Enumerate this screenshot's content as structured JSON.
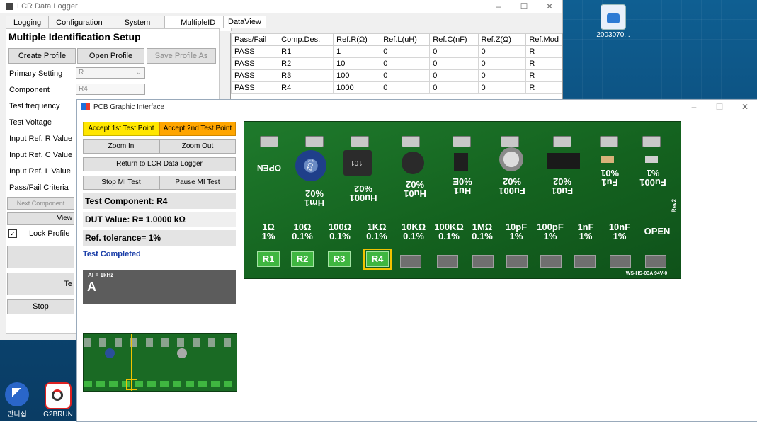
{
  "lcr": {
    "title": "LCR Data Logger",
    "tabs": [
      "Logging",
      "Configuration",
      "System",
      "MultipleID"
    ],
    "setup_title": "Multiple Identification  Setup",
    "buttons": {
      "create_profile": "Create Profile",
      "open_profile": "Open Profile",
      "save_profile_as": "Save Profile As",
      "next_component": "Next Component",
      "view": "View",
      "stop": "Stop",
      "te": "Te"
    },
    "labels": {
      "primary_setting": "Primary Setting",
      "component": "Component",
      "test_frequency": "Test frequency",
      "test_voltage": "Test Voltage",
      "input_ref_r": "Input Ref. R Value",
      "input_ref_c": "Input Ref. C Value",
      "input_ref_l": "Input Ref. L Value",
      "pass_fail": "Pass/Fail Criteria",
      "lock_profile": "Lock Profile"
    },
    "values": {
      "primary_setting": "R",
      "component": "R4"
    }
  },
  "dataview": {
    "tab": "DataView",
    "columns": [
      "Pass/Fail",
      "Comp.Des.",
      "Ref.R(Ω)",
      "Ref.L(uH)",
      "Ref.C(nF)",
      "Ref.Z(Ω)",
      "Ref.Mod"
    ],
    "rows": [
      [
        "PASS",
        "R1",
        "1",
        "0",
        "0",
        "0",
        "R"
      ],
      [
        "PASS",
        "R2",
        "10",
        "0",
        "0",
        "0",
        "R"
      ],
      [
        "PASS",
        "R3",
        "100",
        "0",
        "0",
        "0",
        "R"
      ],
      [
        "PASS",
        "R4",
        "1000",
        "0",
        "0",
        "0",
        "R"
      ]
    ]
  },
  "pcb": {
    "title": "PCB Graphic Interface",
    "buttons": {
      "accept1": "Accept 1st Test Point",
      "accept2": "Accept 2nd Test Point",
      "zoom_in": "Zoom In",
      "zoom_out": "Zoom Out",
      "return": "Return to LCR Data Logger",
      "stop_mi": "Stop MI Test",
      "pause_mi": "Pause MI Test"
    },
    "test_component": "Test Component: R4",
    "dut_value": "DUT Value: R= 1.0000 kΩ",
    "ref_tolerance": "Ref. tolerance= 1%",
    "status": "Test Completed",
    "meter_af": "AF= 1kHz",
    "meter_mode": "A",
    "board": {
      "open_top": "OPEN",
      "rev": "Rev2",
      "top_parts": [
        "102",
        "101"
      ],
      "flipped_labels": [
        [
          "%02",
          "Hm1"
        ],
        [
          "%02",
          "Hu001"
        ],
        [
          "%02",
          "Hu01"
        ],
        [
          "%0E",
          "Hu1"
        ],
        [
          "%02",
          "Fu001"
        ],
        [
          "%02",
          "Fu01"
        ],
        [
          "%01",
          "Fu1"
        ],
        [
          "%1",
          "Fu001"
        ]
      ],
      "values": [
        [
          "1Ω",
          "1%"
        ],
        [
          "10Ω",
          "0.1%"
        ],
        [
          "100Ω",
          "0.1%"
        ],
        [
          "1KΩ",
          "0.1%"
        ],
        [
          "10KΩ",
          "0.1%"
        ],
        [
          "100KΩ",
          "0.1%"
        ],
        [
          "1MΩ",
          "0.1%"
        ],
        [
          "10pF",
          "1%"
        ],
        [
          "100pF",
          "1%"
        ],
        [
          "1nF",
          "1%"
        ],
        [
          "10nF",
          "1%"
        ],
        [
          "OPEN",
          ""
        ]
      ],
      "test_points": [
        "R1",
        "R2",
        "R3",
        "R4"
      ],
      "part_no": "WS-HS-03A 94V-0"
    }
  },
  "desktop": {
    "icon1": "2003070...",
    "icon2": "반디집",
    "icon3": "G2BRUN"
  },
  "colors": {
    "accept1": "#ffe600",
    "accept2": "#ffa500",
    "board": "#1f7a2c",
    "active_tp": "#3fb640",
    "selected_tp": "#f2c300",
    "status": "#1a3ea8"
  }
}
